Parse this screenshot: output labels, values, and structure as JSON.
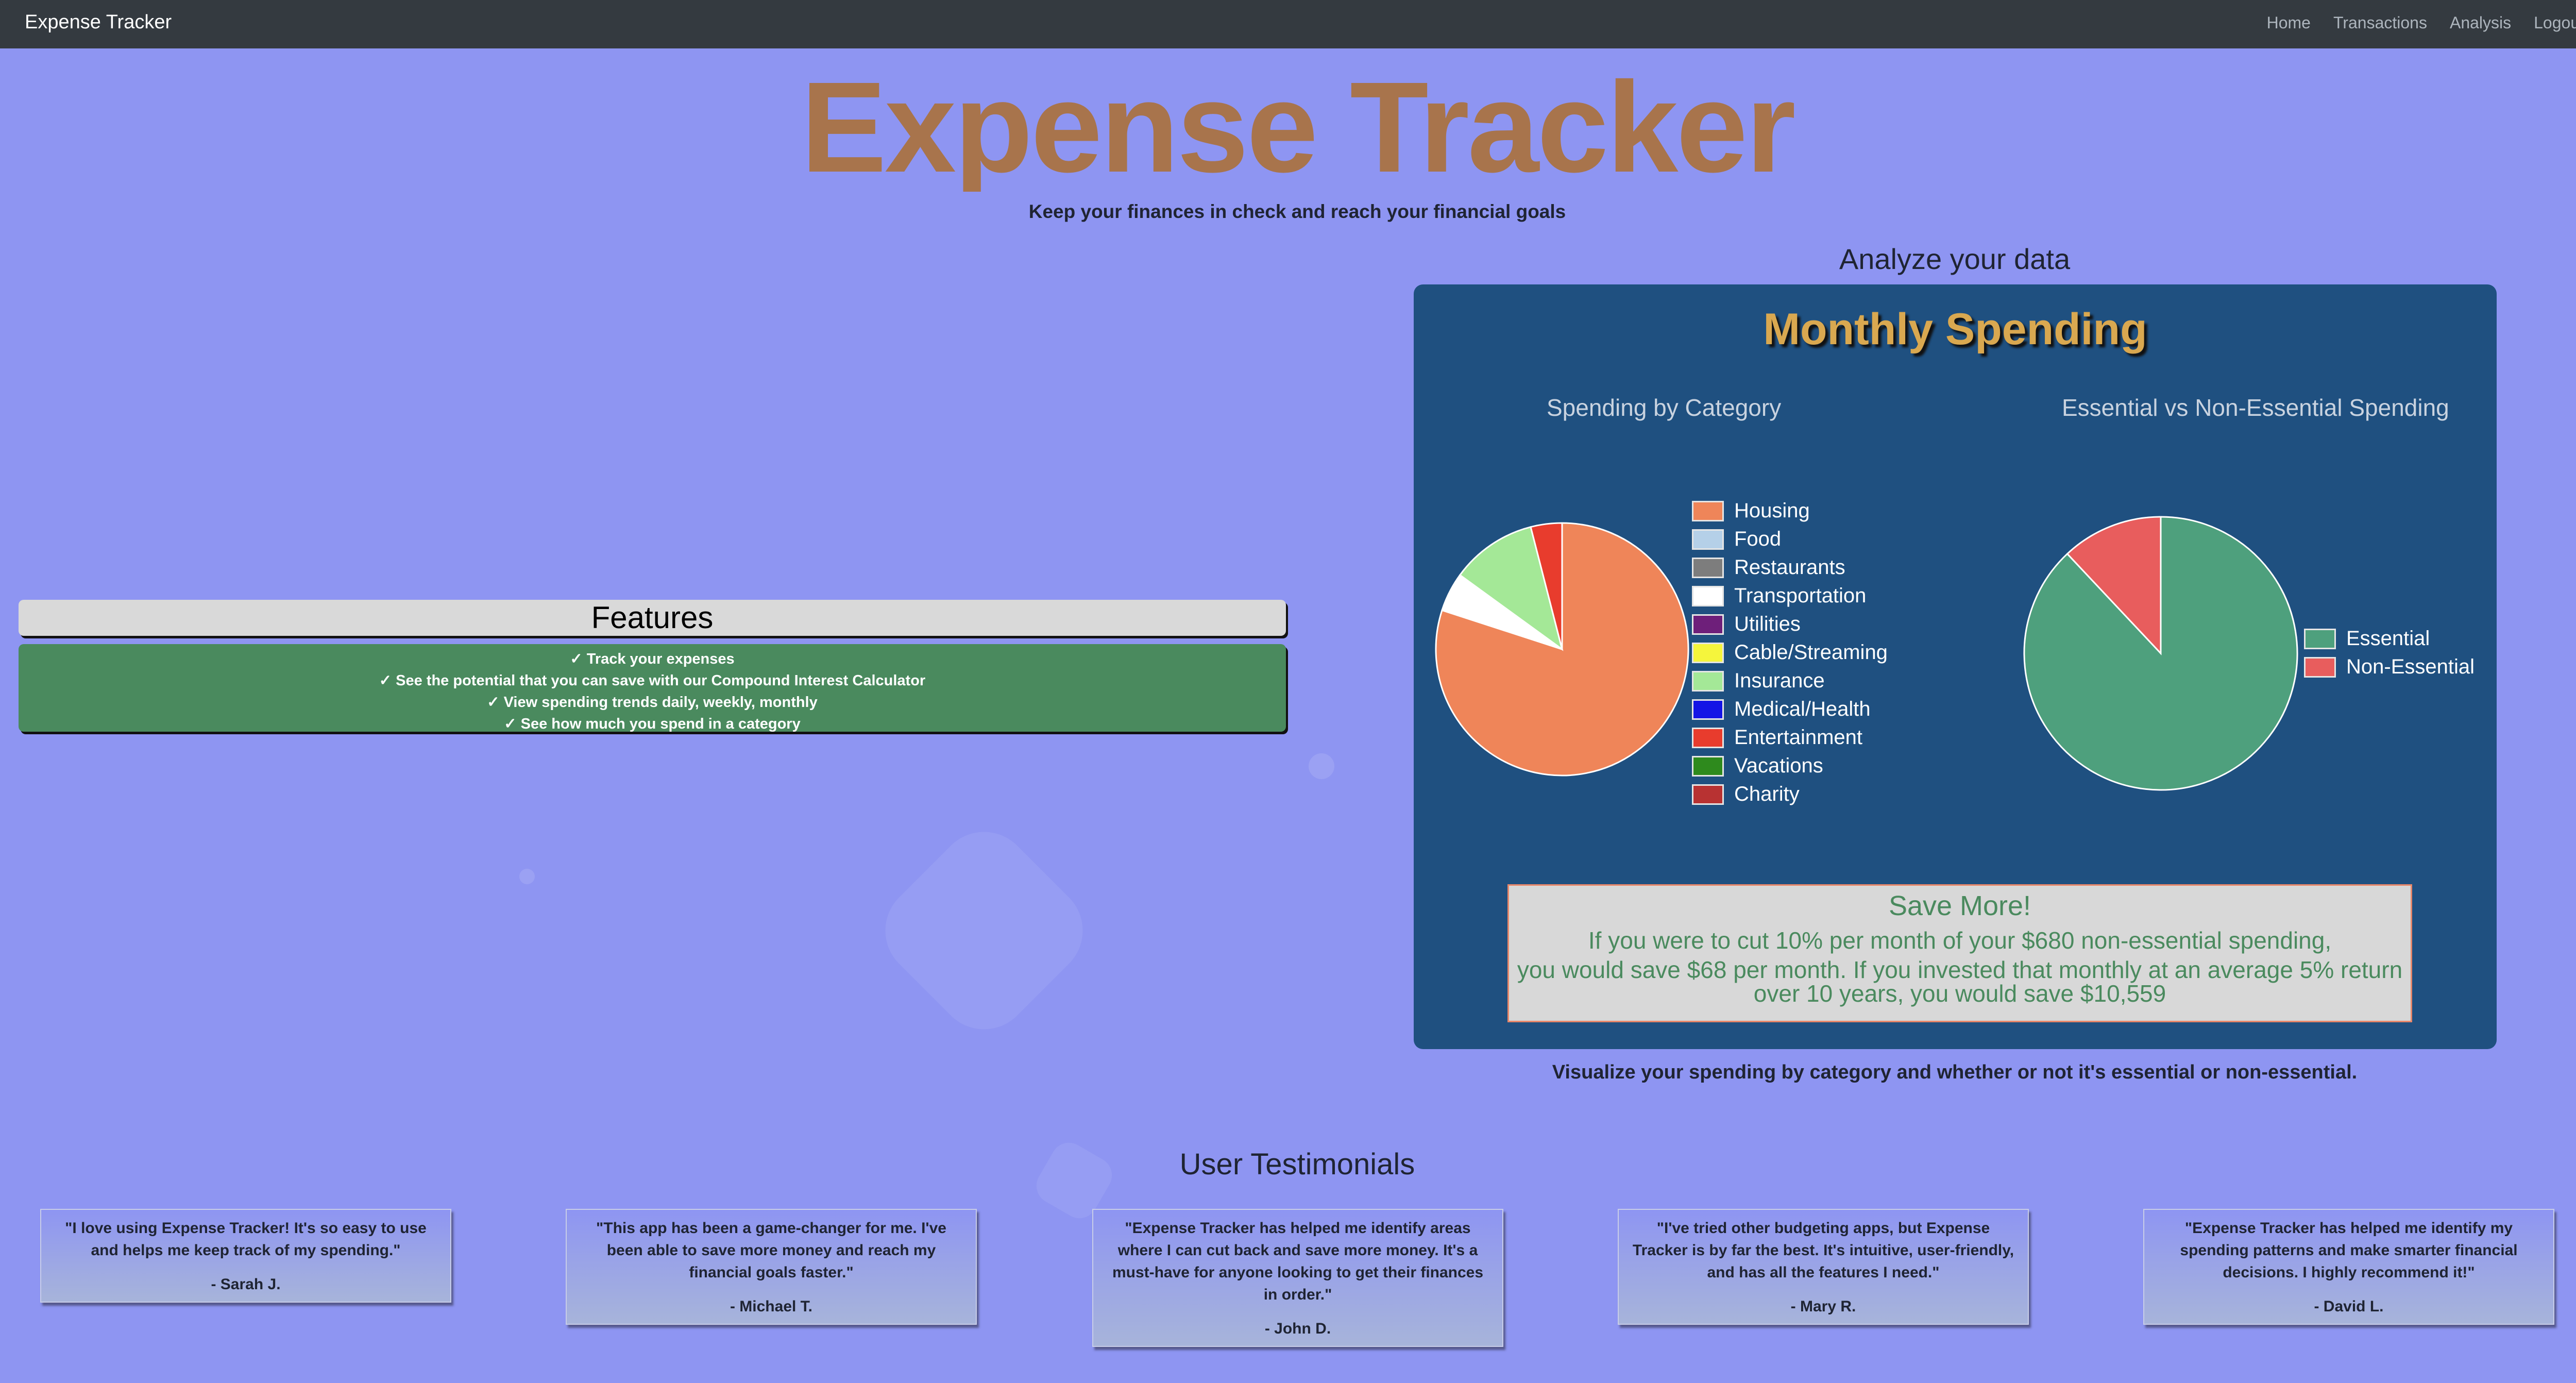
{
  "navbar": {
    "brand": "Expense Tracker",
    "links": [
      "Home",
      "Transactions",
      "Analysis",
      "Logout"
    ]
  },
  "hero": {
    "title": "Expense Tracker",
    "tagline": "Keep your finances in check and reach your financial goals"
  },
  "features": {
    "heading": "Features",
    "items": [
      "✓ Track your expenses",
      "✓ See the potential that you can save with our Compound Interest Calculator",
      "✓ View spending trends daily, weekly, monthly",
      "✓ See how much you spend in a category"
    ]
  },
  "analysis": {
    "heading": "Analyze your data",
    "panel_title": "Monthly Spending",
    "caption": "Visualize your spending by category and whether or not it's essential or non-essential."
  },
  "save_more": {
    "heading": "Save More!",
    "line1": "If you were to cut 10% per month of your $680 non-essential spending,",
    "line2": "you would save $68 per month. If you invested that monthly at an average 5% return",
    "line3": "over 10 years, you would save $10,559"
  },
  "chart_data": [
    {
      "type": "pie",
      "title": "Spending by Category",
      "categories": [
        "Housing",
        "Food",
        "Restaurants",
        "Transportation",
        "Utilities",
        "Cable/Streaming",
        "Insurance",
        "Medical/Health",
        "Entertainment",
        "Vacations",
        "Charity"
      ],
      "values": [
        80,
        0,
        0,
        5,
        0,
        0,
        11,
        0,
        4,
        0,
        0
      ],
      "colors": [
        "#ef8559",
        "#b5d0e8",
        "#7d7d7d",
        "#ffffff",
        "#6e1f7a",
        "#f5f53c",
        "#a4e897",
        "#1414e6",
        "#e83c2d",
        "#2e8a1d",
        "#b83232"
      ],
      "legend": "right"
    },
    {
      "type": "pie",
      "title": "Essential vs Non-Essential Spending",
      "categories": [
        "Essential",
        "Non-Essential"
      ],
      "values": [
        88,
        12
      ],
      "colors": [
        "#4ea07d",
        "#e85d5d"
      ],
      "legend": "right"
    }
  ],
  "testimonials": [
    {
      "quote": "\"I love using Expense Tracker! It's so easy to use and helps me keep track of my spending.\"",
      "author": "- Sarah J."
    },
    {
      "quote": "\"This app has been a game-changer for me. I've been able to save more money and reach my financial goals faster.\"",
      "author": "- Michael T."
    },
    {
      "quote": "\"Expense Tracker has helped me identify areas where I can cut back and save more money. It's a must-have for anyone looking to get their finances in order.\"",
      "author": "- John D."
    },
    {
      "quote": "\"I've tried other budgeting apps, but Expense Tracker is by far the best. It's intuitive, user-friendly, and has all the features I need.\"",
      "author": "- Mary R."
    },
    {
      "quote": "\"Expense Tracker has helped me identify my spending patterns and make smarter financial decisions. I highly recommend it!\"",
      "author": "- David L."
    }
  ],
  "testimonials_heading": "User Testimonials"
}
